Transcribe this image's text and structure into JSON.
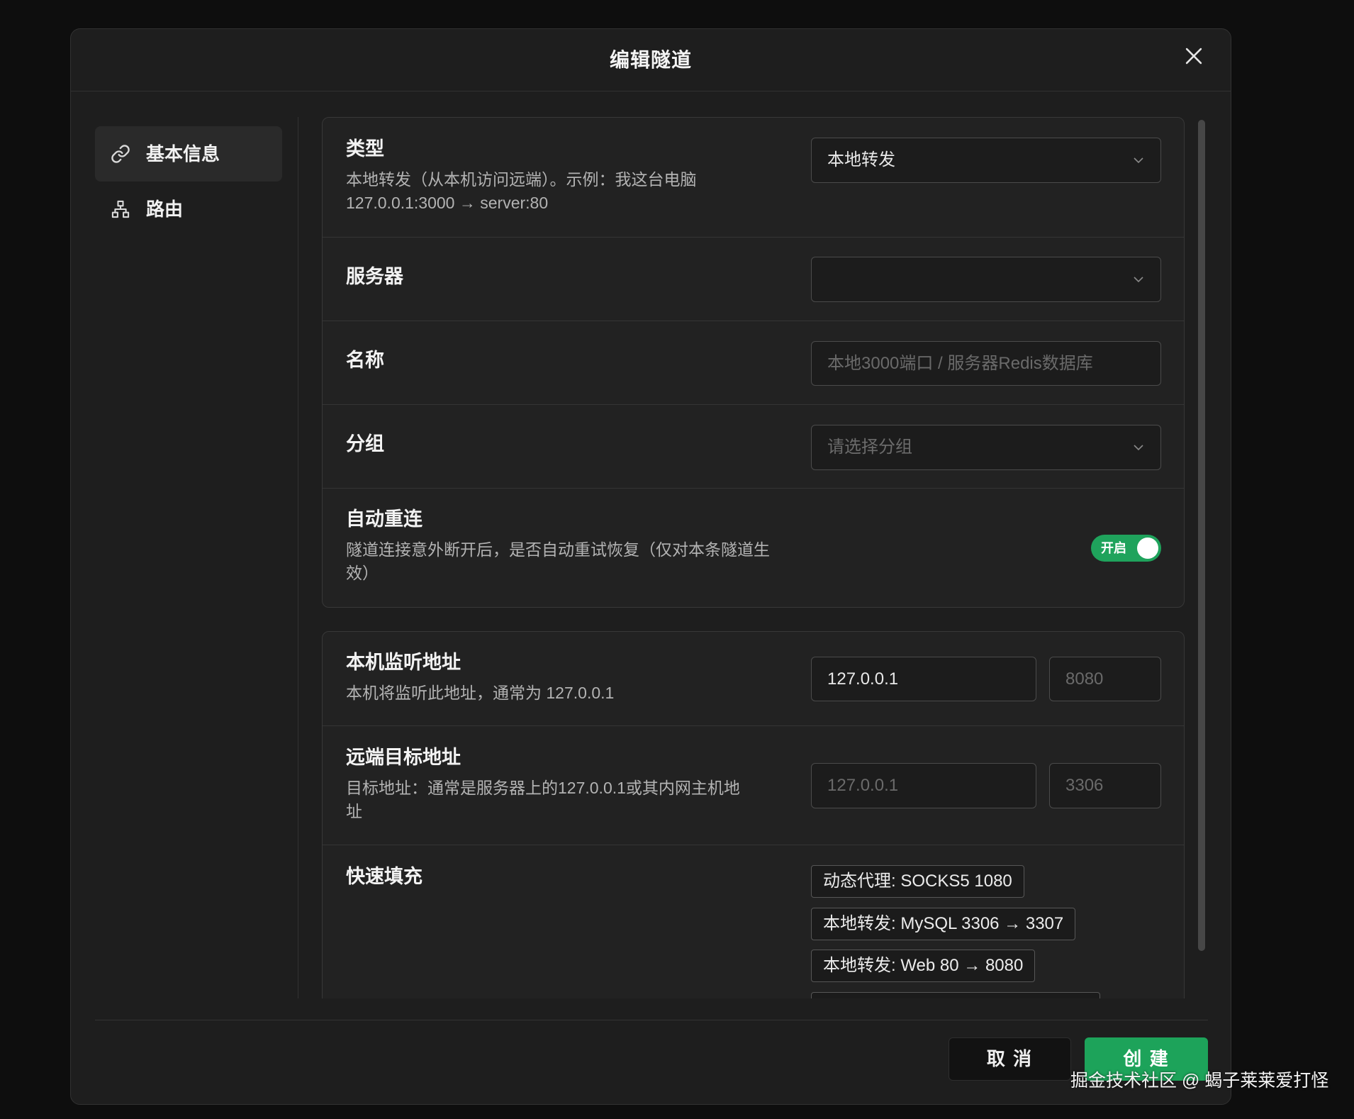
{
  "dialog": {
    "title": "编辑隧道"
  },
  "sidebar": {
    "items": [
      {
        "label": "基本信息",
        "icon": "link-icon",
        "active": true
      },
      {
        "label": "路由",
        "icon": "sitemap-icon",
        "active": false
      }
    ]
  },
  "basic": {
    "type": {
      "label": "类型",
      "description": [
        "本地转发（从本机访问远端）。示例：我这台电脑",
        "127.0.0.1:3000 → server:80"
      ],
      "value": "本地转发"
    },
    "server": {
      "label": "服务器"
    },
    "name": {
      "label": "名称",
      "placeholder": "本地3000端口 / 服务器Redis数据库"
    },
    "group": {
      "label": "分组",
      "placeholder": "请选择分组"
    },
    "auto_reconnect": {
      "label": "自动重连",
      "description": [
        "隧道连接意外断开后，是否自动重试恢复（仅对本条隧道生",
        "效）"
      ],
      "toggle_label": "开启",
      "enabled": true
    }
  },
  "address": {
    "local": {
      "label": "本机监听地址",
      "description": "本机将监听此地址，通常为 127.0.0.1",
      "host_value": "127.0.0.1",
      "port_placeholder": "8080"
    },
    "remote": {
      "label": "远端目标地址",
      "description": [
        "目标地址：通常是服务器上的127.0.0.1或其内网主机地",
        "址"
      ],
      "host_placeholder": "127.0.0.1",
      "port_placeholder": "3306"
    },
    "quick_fill": {
      "label": "快速填充",
      "chips": [
        "动态代理: SOCKS5 1080",
        "本地转发: MySQL 3306 → 3307",
        "本地转发: Web 80 → 8080"
      ]
    }
  },
  "footer": {
    "cancel_label": "取 消",
    "create_label": "创 建"
  },
  "watermark": "掘金技术社区 @ 蝎子莱莱爱打怪",
  "colors": {
    "accent": "#1fa35c",
    "dialog_bg": "#1e1e1e",
    "card_bg": "#222222"
  }
}
